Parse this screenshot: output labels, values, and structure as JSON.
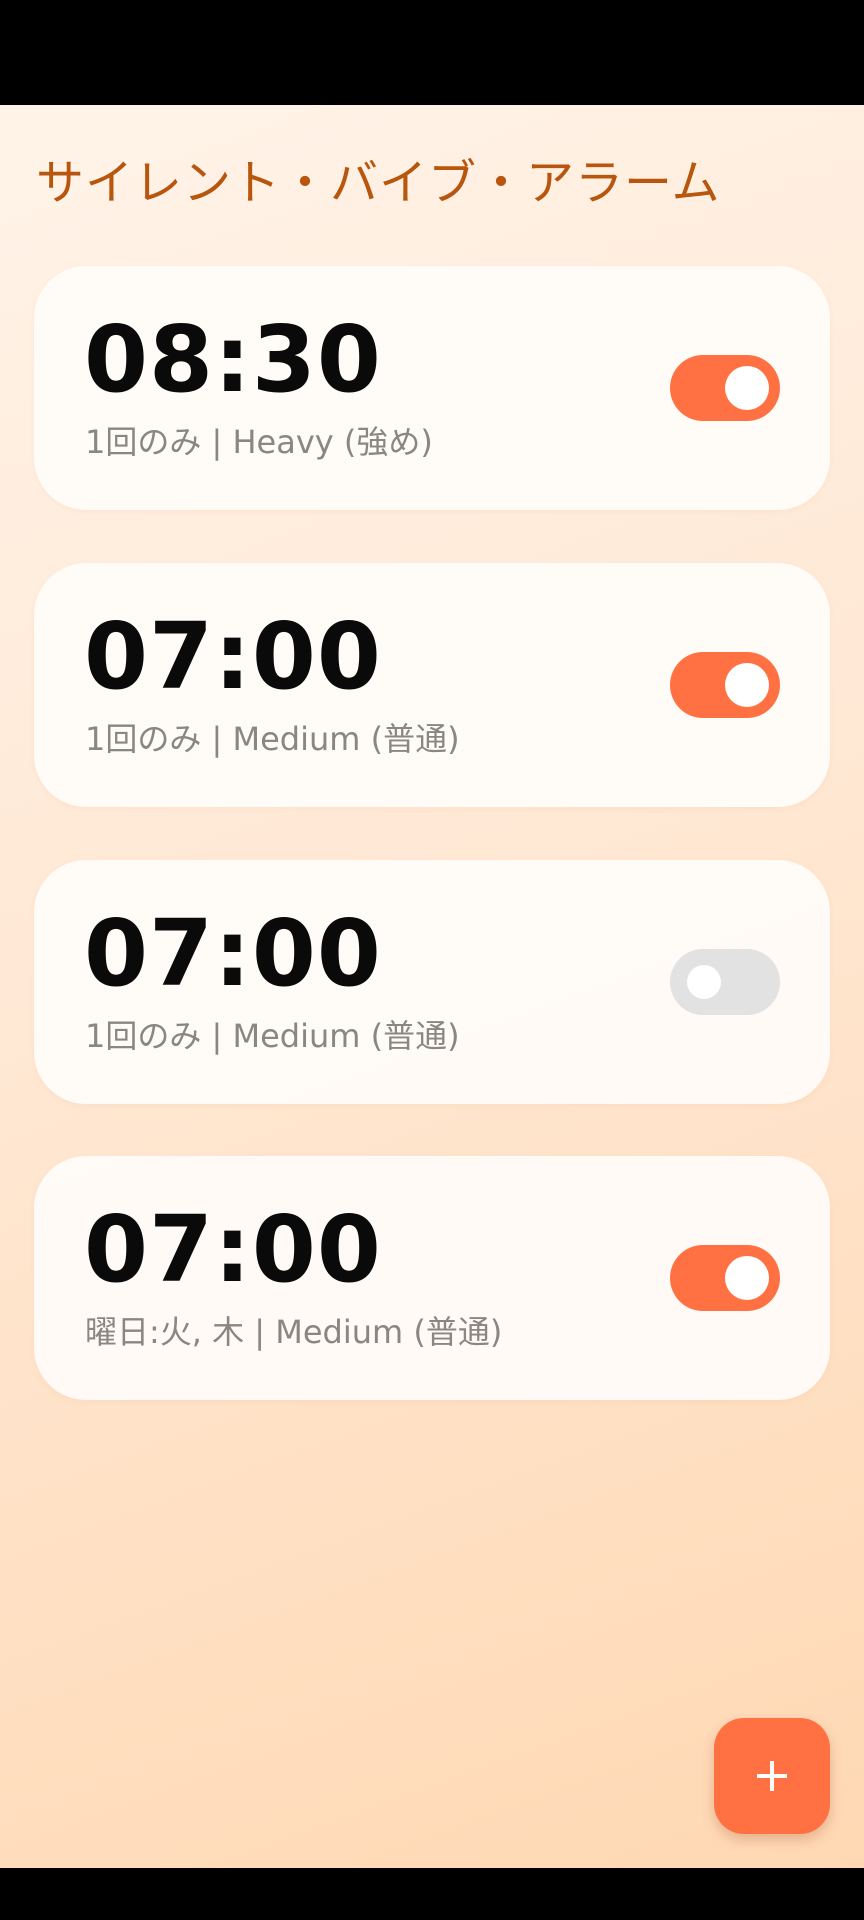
{
  "app": {
    "title": "サイレント・バイブ・アラーム"
  },
  "alarms": [
    {
      "time": "08:30",
      "detail": "1回のみ | Heavy (強め)",
      "enabled": true
    },
    {
      "time": "07:00",
      "detail": "1回のみ | Medium (普通)",
      "enabled": true
    },
    {
      "time": "07:00",
      "detail": "1回のみ | Medium (普通)",
      "enabled": false
    },
    {
      "time": "07:00",
      "detail": "曜日:火, 木 | Medium (普通)",
      "enabled": true
    }
  ],
  "fab": {
    "icon": "plus-icon"
  },
  "colors": {
    "accent": "#ff7043",
    "title": "#b8560e",
    "toggle_off": "#e2e2e2",
    "detail_text": "#8a8783"
  }
}
